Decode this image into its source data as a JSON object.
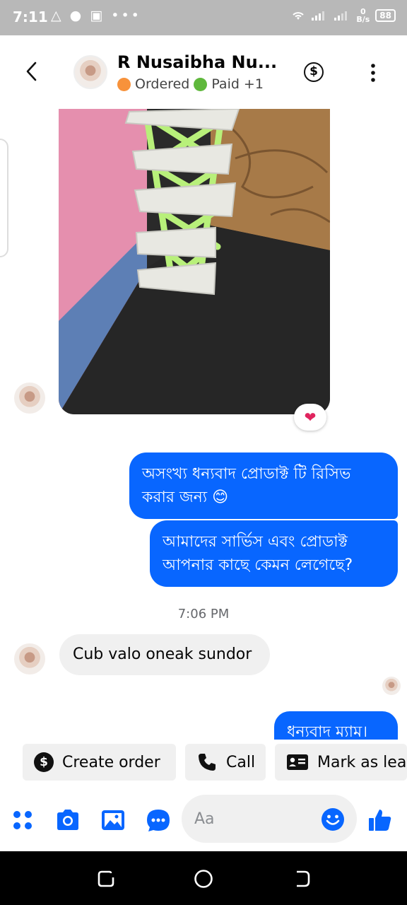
{
  "status_bar": {
    "time": "7:11",
    "left_icons": "△ ● ▣ •••",
    "net_speed": "0\nB/s",
    "battery": "88"
  },
  "header": {
    "contact_name": "R Nusaibha Nu...",
    "tags": [
      {
        "label": "Ordered",
        "color": "#f7923b"
      },
      {
        "label": "Paid",
        "color": "#5fb83c"
      }
    ],
    "more_tags": "+1",
    "dollar_symbol": "$"
  },
  "chat": {
    "reaction": "❤",
    "outgoing_1": "অসংখ্য ধন্যবাদ প্রোডাক্ট টি রিসিভ করার জন্য 😊",
    "outgoing_2": "আমাদের সার্ভিস এবং প্রোডাক্ট আপনার কাছে কেমন লেগেছে?",
    "timestamp": "7:06 PM",
    "incoming_1": "Cub valo oneak sundor",
    "outgoing_3": "ধন্যবাদ ম্যাম।"
  },
  "quick_actions": {
    "create_order": "Create order",
    "call": "Call",
    "mark_as_lead": "Mark as lead"
  },
  "composer": {
    "placeholder": "Aa"
  },
  "colors": {
    "accent": "#0866ff",
    "bubble_in": "#f0f0f0",
    "status_bar": "#b8b8b8"
  }
}
